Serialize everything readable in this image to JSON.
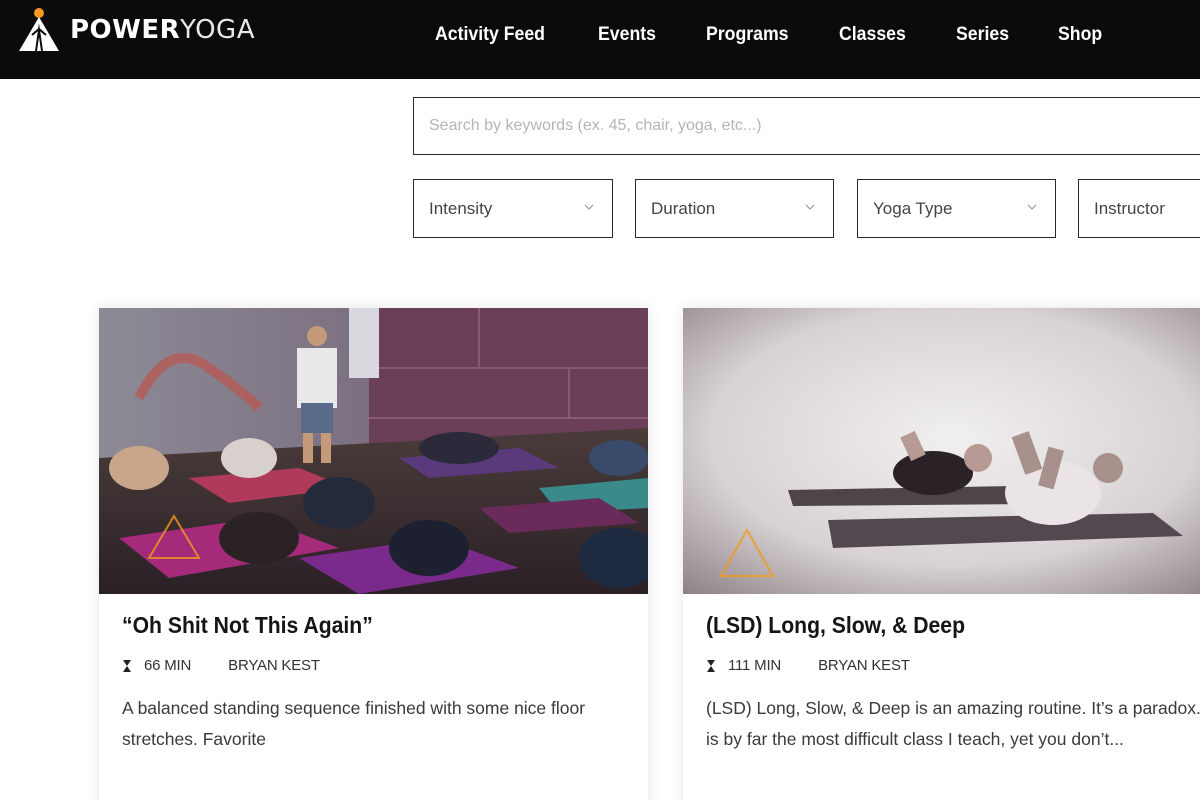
{
  "brand": {
    "name_bold": "POWER",
    "name_light": "YOGA",
    "accent_color": "#f39a1e",
    "logo_icon": "power-yoga-logo-icon"
  },
  "nav": {
    "items": [
      "Activity Feed",
      "Events",
      "Programs",
      "Classes",
      "Series",
      "Shop"
    ]
  },
  "search": {
    "placeholder": "Search by keywords (ex. 45, chair, yoga, etc...)",
    "value": ""
  },
  "filters": [
    {
      "label": "Intensity",
      "icon": "chevron-down-icon"
    },
    {
      "label": "Duration",
      "icon": "chevron-down-icon"
    },
    {
      "label": "Yoga Type",
      "icon": "chevron-down-icon"
    },
    {
      "label": "Instructor",
      "icon": "chevron-down-icon"
    }
  ],
  "cards": [
    {
      "title": "“Oh Shit Not This Again”",
      "duration": "66 MIN",
      "instructor": "BRYAN KEST",
      "description": "A balanced standing sequence finished with some nice floor stretches. Favorite",
      "image": "yoga class lying on mats photo",
      "duration_icon": "hourglass-icon"
    },
    {
      "title": "(LSD) Long, Slow, & Deep",
      "duration": "111 MIN",
      "instructor": "BRYAN KEST",
      "description": "(LSD) Long, Slow, & Deep is an amazing routine. It’s a paradox. It is by far the most difficult class I teach, yet you don’t...",
      "image": "two people stretching on mats photo",
      "duration_icon": "hourglass-icon"
    }
  ]
}
